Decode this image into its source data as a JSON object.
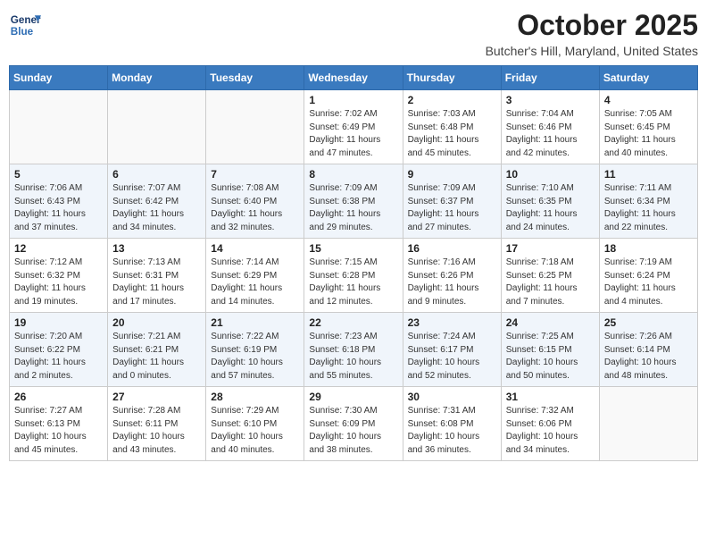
{
  "header": {
    "logo_general": "General",
    "logo_blue": "Blue",
    "month_title": "October 2025",
    "location": "Butcher's Hill, Maryland, United States"
  },
  "days_of_week": [
    "Sunday",
    "Monday",
    "Tuesday",
    "Wednesday",
    "Thursday",
    "Friday",
    "Saturday"
  ],
  "weeks": [
    [
      {
        "day": "",
        "info": ""
      },
      {
        "day": "",
        "info": ""
      },
      {
        "day": "",
        "info": ""
      },
      {
        "day": "1",
        "info": "Sunrise: 7:02 AM\nSunset: 6:49 PM\nDaylight: 11 hours\nand 47 minutes."
      },
      {
        "day": "2",
        "info": "Sunrise: 7:03 AM\nSunset: 6:48 PM\nDaylight: 11 hours\nand 45 minutes."
      },
      {
        "day": "3",
        "info": "Sunrise: 7:04 AM\nSunset: 6:46 PM\nDaylight: 11 hours\nand 42 minutes."
      },
      {
        "day": "4",
        "info": "Sunrise: 7:05 AM\nSunset: 6:45 PM\nDaylight: 11 hours\nand 40 minutes."
      }
    ],
    [
      {
        "day": "5",
        "info": "Sunrise: 7:06 AM\nSunset: 6:43 PM\nDaylight: 11 hours\nand 37 minutes."
      },
      {
        "day": "6",
        "info": "Sunrise: 7:07 AM\nSunset: 6:42 PM\nDaylight: 11 hours\nand 34 minutes."
      },
      {
        "day": "7",
        "info": "Sunrise: 7:08 AM\nSunset: 6:40 PM\nDaylight: 11 hours\nand 32 minutes."
      },
      {
        "day": "8",
        "info": "Sunrise: 7:09 AM\nSunset: 6:38 PM\nDaylight: 11 hours\nand 29 minutes."
      },
      {
        "day": "9",
        "info": "Sunrise: 7:09 AM\nSunset: 6:37 PM\nDaylight: 11 hours\nand 27 minutes."
      },
      {
        "day": "10",
        "info": "Sunrise: 7:10 AM\nSunset: 6:35 PM\nDaylight: 11 hours\nand 24 minutes."
      },
      {
        "day": "11",
        "info": "Sunrise: 7:11 AM\nSunset: 6:34 PM\nDaylight: 11 hours\nand 22 minutes."
      }
    ],
    [
      {
        "day": "12",
        "info": "Sunrise: 7:12 AM\nSunset: 6:32 PM\nDaylight: 11 hours\nand 19 minutes."
      },
      {
        "day": "13",
        "info": "Sunrise: 7:13 AM\nSunset: 6:31 PM\nDaylight: 11 hours\nand 17 minutes."
      },
      {
        "day": "14",
        "info": "Sunrise: 7:14 AM\nSunset: 6:29 PM\nDaylight: 11 hours\nand 14 minutes."
      },
      {
        "day": "15",
        "info": "Sunrise: 7:15 AM\nSunset: 6:28 PM\nDaylight: 11 hours\nand 12 minutes."
      },
      {
        "day": "16",
        "info": "Sunrise: 7:16 AM\nSunset: 6:26 PM\nDaylight: 11 hours\nand 9 minutes."
      },
      {
        "day": "17",
        "info": "Sunrise: 7:18 AM\nSunset: 6:25 PM\nDaylight: 11 hours\nand 7 minutes."
      },
      {
        "day": "18",
        "info": "Sunrise: 7:19 AM\nSunset: 6:24 PM\nDaylight: 11 hours\nand 4 minutes."
      }
    ],
    [
      {
        "day": "19",
        "info": "Sunrise: 7:20 AM\nSunset: 6:22 PM\nDaylight: 11 hours\nand 2 minutes."
      },
      {
        "day": "20",
        "info": "Sunrise: 7:21 AM\nSunset: 6:21 PM\nDaylight: 11 hours\nand 0 minutes."
      },
      {
        "day": "21",
        "info": "Sunrise: 7:22 AM\nSunset: 6:19 PM\nDaylight: 10 hours\nand 57 minutes."
      },
      {
        "day": "22",
        "info": "Sunrise: 7:23 AM\nSunset: 6:18 PM\nDaylight: 10 hours\nand 55 minutes."
      },
      {
        "day": "23",
        "info": "Sunrise: 7:24 AM\nSunset: 6:17 PM\nDaylight: 10 hours\nand 52 minutes."
      },
      {
        "day": "24",
        "info": "Sunrise: 7:25 AM\nSunset: 6:15 PM\nDaylight: 10 hours\nand 50 minutes."
      },
      {
        "day": "25",
        "info": "Sunrise: 7:26 AM\nSunset: 6:14 PM\nDaylight: 10 hours\nand 48 minutes."
      }
    ],
    [
      {
        "day": "26",
        "info": "Sunrise: 7:27 AM\nSunset: 6:13 PM\nDaylight: 10 hours\nand 45 minutes."
      },
      {
        "day": "27",
        "info": "Sunrise: 7:28 AM\nSunset: 6:11 PM\nDaylight: 10 hours\nand 43 minutes."
      },
      {
        "day": "28",
        "info": "Sunrise: 7:29 AM\nSunset: 6:10 PM\nDaylight: 10 hours\nand 40 minutes."
      },
      {
        "day": "29",
        "info": "Sunrise: 7:30 AM\nSunset: 6:09 PM\nDaylight: 10 hours\nand 38 minutes."
      },
      {
        "day": "30",
        "info": "Sunrise: 7:31 AM\nSunset: 6:08 PM\nDaylight: 10 hours\nand 36 minutes."
      },
      {
        "day": "31",
        "info": "Sunrise: 7:32 AM\nSunset: 6:06 PM\nDaylight: 10 hours\nand 34 minutes."
      },
      {
        "day": "",
        "info": ""
      }
    ]
  ]
}
